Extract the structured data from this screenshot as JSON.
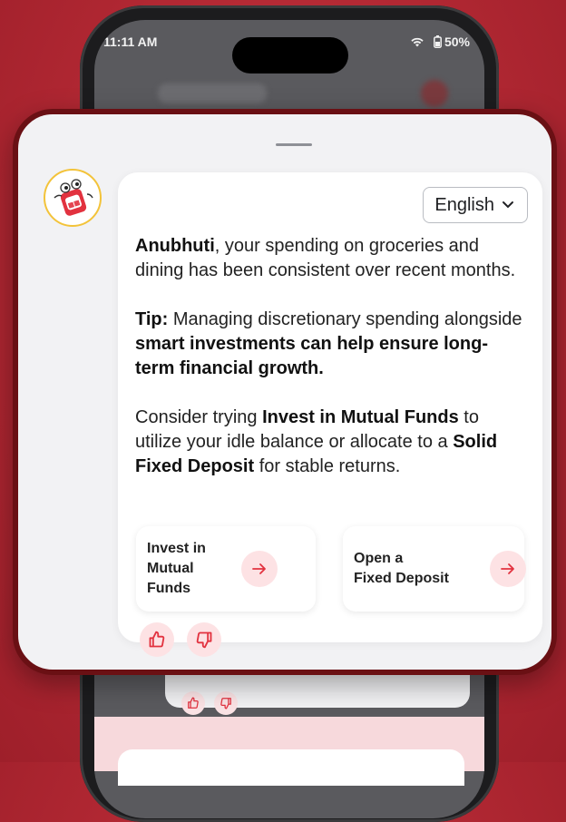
{
  "status_bar": {
    "time": "11:11 AM",
    "battery": "50%"
  },
  "language_select": {
    "value": "English"
  },
  "message": {
    "p1_name": "Anubhuti",
    "p1_rest": ", your spending on groceries and dining has been consistent over recent months.",
    "p2_tip": "Tip:",
    "p2_text": " Managing discretionary spending alongside ",
    "p2_bold": "smart investments can help ensure long-term financial growth.",
    "p3_text1": "Consider trying ",
    "p3_bold1": "Invest in Mutual Funds",
    "p3_text2": " to utilize your idle balance or allocate to a ",
    "p3_bold2": "Solid Fixed Deposit",
    "p3_text3": " for stable returns."
  },
  "actions": [
    {
      "label": "Invest in\nMutual\nFunds"
    },
    {
      "label": "Open a\nFixed Deposit"
    }
  ],
  "colors": {
    "accent": "#e2323f",
    "accent_bg": "#fde2e4",
    "border": "#6a1014",
    "background": "#b22833"
  },
  "icons": [
    "wifi-icon",
    "battery-icon",
    "chevron-down-icon",
    "arrow-right-icon",
    "thumbs-up-icon",
    "thumbs-down-icon",
    "assistant-avatar-icon"
  ]
}
